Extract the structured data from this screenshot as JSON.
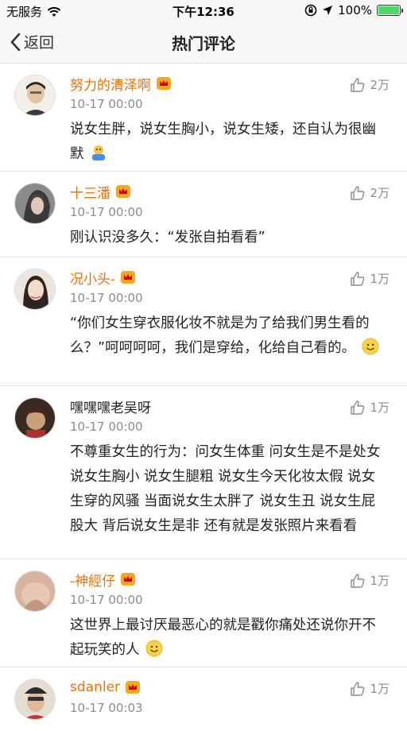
{
  "status_bar": {
    "carrier": "无服务",
    "time": "下午12:36",
    "battery": "100%",
    "battery_level": 1.0
  },
  "nav": {
    "back_label": "返回",
    "title": "热门评论"
  },
  "comments": [
    {
      "name": "努力的清泽啊",
      "vip": true,
      "time": "10-17 00:00",
      "likes": "2万",
      "text": "说女生胖，说女生胸小，说女生矮，还自认为很幽默",
      "emoji": "shrug-emoji"
    },
    {
      "name": "十三潘",
      "vip": true,
      "time": "10-17 00:00",
      "likes": "2万",
      "text": "刚认识没多久：“发张自拍看看”",
      "emoji": ""
    },
    {
      "name": "况小头-",
      "vip": true,
      "time": "10-17 00:00",
      "likes": "1万",
      "text": "“你们女生穿衣服化妆不就是为了给我们男生看的么？”呵呵呵呵，我们是穿给，化给自己看的。",
      "emoji": "smile-emoji"
    },
    {
      "name": "嘿嘿嘿老吴呀",
      "vip": false,
      "time": "10-17 00:00",
      "likes": "1万",
      "text": "不尊重女生的行为：问女生体重 问女生是不是处女 说女生胸小 说女生腿粗 说女生今天化妆太假 说女生穿的风骚 当面说女生太胖了 说女生丑 说女生屁股大 背后说女生是非 还有就是发张照片来看看",
      "emoji": ""
    },
    {
      "name": "-神經仔",
      "vip": true,
      "time": "10-17 00:00",
      "likes": "1万",
      "text": "这世界上最讨厌最恶心的就是戳你痛处还说你开不起玩笑的人",
      "emoji": "smile-emoji"
    },
    {
      "name": "sdanler",
      "vip": true,
      "time": "10-17 00:03",
      "likes": "1万",
      "text": "",
      "emoji": ""
    }
  ],
  "colors": {
    "vip_name": "#e8700c",
    "meta": "#8c8c8c",
    "bar_bg": "#f7f7f7"
  }
}
